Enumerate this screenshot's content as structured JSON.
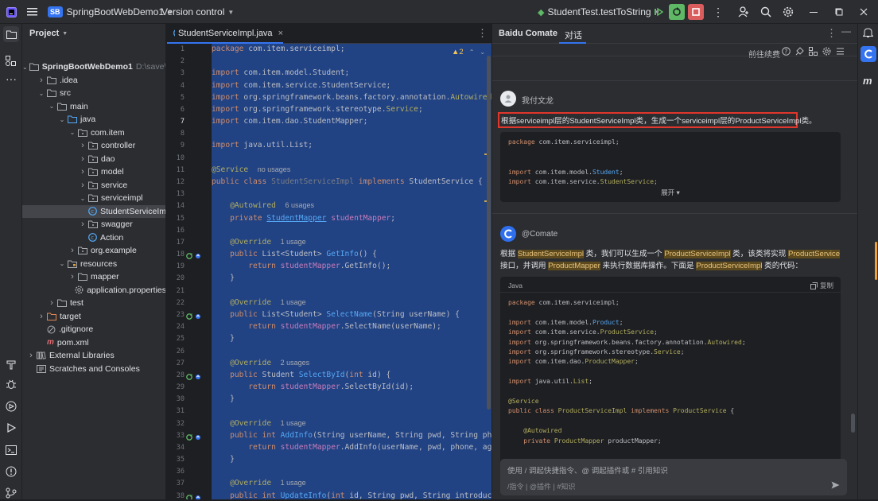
{
  "titlebar": {
    "project_badge": "SB",
    "project_name": "SpringBootWebDemo1",
    "vcs": "Version control",
    "run_config": "StudentTest.testToString"
  },
  "project_panel": {
    "title": "Project",
    "tree": [
      {
        "label": "SpringBootWebDemo1",
        "path": "D:\\save\\st",
        "depth": 0,
        "arrow": "open",
        "icon": "folder",
        "bold": true
      },
      {
        "label": ".idea",
        "depth": 1,
        "arrow": "closed",
        "icon": "folder"
      },
      {
        "label": "src",
        "depth": 1,
        "arrow": "open",
        "icon": "folder"
      },
      {
        "label": "main",
        "depth": 2,
        "arrow": "open",
        "icon": "folder"
      },
      {
        "label": "java",
        "depth": 3,
        "arrow": "open",
        "icon": "folder-blue"
      },
      {
        "label": "com.item",
        "depth": 4,
        "arrow": "open",
        "icon": "package"
      },
      {
        "label": "controller",
        "depth": 5,
        "arrow": "closed",
        "icon": "package"
      },
      {
        "label": "dao",
        "depth": 5,
        "arrow": "closed",
        "icon": "package"
      },
      {
        "label": "model",
        "depth": 5,
        "arrow": "closed",
        "icon": "package"
      },
      {
        "label": "service",
        "depth": 5,
        "arrow": "closed",
        "icon": "package"
      },
      {
        "label": "serviceimpl",
        "depth": 5,
        "arrow": "open",
        "icon": "package"
      },
      {
        "label": "StudentServiceIm",
        "depth": 6,
        "arrow": "none",
        "icon": "class",
        "selected": true
      },
      {
        "label": "swagger",
        "depth": 5,
        "arrow": "closed",
        "icon": "package"
      },
      {
        "label": "Action",
        "depth": 5,
        "arrow": "none",
        "icon": "class"
      },
      {
        "label": "org.example",
        "depth": 4,
        "arrow": "closed",
        "icon": "package"
      },
      {
        "label": "resources",
        "depth": 3,
        "arrow": "open",
        "icon": "folder-res"
      },
      {
        "label": "mapper",
        "depth": 4,
        "arrow": "closed",
        "icon": "folder"
      },
      {
        "label": "application.properties",
        "depth": 4,
        "arrow": "none",
        "icon": "gear"
      },
      {
        "label": "test",
        "depth": 2,
        "arrow": "closed",
        "icon": "folder"
      },
      {
        "label": "target",
        "depth": 1,
        "arrow": "closed",
        "icon": "folder-orange"
      },
      {
        "label": ".gitignore",
        "depth": 1,
        "arrow": "none",
        "icon": "ignore"
      },
      {
        "label": "pom.xml",
        "depth": 1,
        "arrow": "none",
        "icon": "maven"
      },
      {
        "label": "External Libraries",
        "depth": 0,
        "arrow": "closed",
        "icon": "libs"
      },
      {
        "label": "Scratches and Consoles",
        "depth": 0,
        "arrow": "none",
        "icon": "scratch"
      }
    ]
  },
  "editor": {
    "tab_label": "StudentServiceImpl.java",
    "warning_count": "▲2",
    "lines": [
      {
        "n": "1",
        "html": "<span class='kw'>package</span> com.item.serviceimpl;"
      },
      {
        "n": "2",
        "html": ""
      },
      {
        "n": "3",
        "html": "<span class='kw'>import</span> com.item.model.Student;"
      },
      {
        "n": "4",
        "html": "<span class='kw'>import</span> com.item.service.StudentService;"
      },
      {
        "n": "5",
        "html": "<span class='kw'>import</span> org.springframework.beans.factory.annotation.<span class='an'>Autowired</span>;"
      },
      {
        "n": "6",
        "html": "<span class='kw'>import</span> org.springframework.stereotype.<span class='an'>Service</span>;"
      },
      {
        "n": "7",
        "html": "<span class='kw'>import</span> com.item.dao.StudentMapper;"
      },
      {
        "n": "8",
        "html": ""
      },
      {
        "n": "9",
        "html": "<span class='kw'>import</span> java.util.List;"
      },
      {
        "n": "10",
        "html": ""
      },
      {
        "n": "11",
        "html": "<span class='an'>@Service</span>  <span class='hint'>no usages</span>"
      },
      {
        "n": "12",
        "html": "<span class='kw'>public class</span> <span class='gr'>StudentServiceImpl</span> <span class='kw'>implements</span> StudentService {"
      },
      {
        "n": "13",
        "html": ""
      },
      {
        "n": "14",
        "html": "    <span class='an'>@Autowired</span>  <span class='hint'>6 usages</span>"
      },
      {
        "n": "15",
        "html": "    <span class='kw'>private</span> <span class='fn' style='text-decoration:underline'>StudentMapper</span> <span class='fd'>studentMapper</span>;"
      },
      {
        "n": "16",
        "html": ""
      },
      {
        "n": "17",
        "html": "    <span class='an'>@Override</span>  <span class='hint'>1 usage</span>"
      },
      {
        "n": "18",
        "html": "    <span class='kw'>public</span> List&lt;Student&gt; <span class='fn'>GetInfo</span>() {"
      },
      {
        "n": "19",
        "html": "        <span class='kw'>return</span> <span class='fd'>studentMapper</span>.GetInfo();"
      },
      {
        "n": "20",
        "html": "    }"
      },
      {
        "n": "21",
        "html": ""
      },
      {
        "n": "22",
        "html": "    <span class='an'>@Override</span>  <span class='hint'>1 usage</span>"
      },
      {
        "n": "23",
        "html": "    <span class='kw'>public</span> List&lt;Student&gt; <span class='fn'>SelectName</span>(String userName) {"
      },
      {
        "n": "24",
        "html": "        <span class='kw'>return</span> <span class='fd'>studentMapper</span>.SelectName(userName);"
      },
      {
        "n": "25",
        "html": "    }"
      },
      {
        "n": "26",
        "html": ""
      },
      {
        "n": "27",
        "html": "    <span class='an'>@Override</span>  <span class='hint'>2 usages</span>"
      },
      {
        "n": "28",
        "html": "    <span class='kw'>public</span> Student <span class='fn'>SelectById</span>(<span class='kw'>int</span> id) {"
      },
      {
        "n": "29",
        "html": "        <span class='kw'>return</span> <span class='fd'>studentMapper</span>.SelectById(id);"
      },
      {
        "n": "30",
        "html": "    }"
      },
      {
        "n": "31",
        "html": ""
      },
      {
        "n": "32",
        "html": "    <span class='an'>@Override</span>  <span class='hint'>1 usage</span>"
      },
      {
        "n": "33",
        "html": "    <span class='kw'>public int</span> <span class='fn'>AddInfo</span>(String userName, String pwd, String phone"
      },
      {
        "n": "34",
        "html": "        <span class='kw'>return</span> <span class='fd'>studentMapper</span>.AddInfo(userName, pwd, phone, age,"
      },
      {
        "n": "35",
        "html": "    }"
      },
      {
        "n": "36",
        "html": ""
      },
      {
        "n": "37",
        "html": "    <span class='an'>@Override</span>  <span class='hint'>1 usage</span>"
      },
      {
        "n": "38",
        "html": "    <span class='kw'>public int</span> <span class='fn'>UpdateInfo</span>(<span class='kw'>int</span> id, String pwd, String introduce)"
      }
    ]
  },
  "chat": {
    "brand": "Baidu Comate",
    "tab": "对话",
    "toolbar_label": "前往续费",
    "user_name": "我付文龙",
    "user_msg": "根据serviceimpl层的StudentServiceImpl类，生成一个serviceimpl层的ProductServiceImpl类。",
    "user_code": [
      {
        "html": "<span class='kw'>package</span> com.item.serviceimpl;"
      },
      {
        "html": ""
      },
      {
        "html": ""
      },
      {
        "html": "<span class='kw'>import</span> com.item.model.<span class='fn'>Student</span>;"
      },
      {
        "html": "<span class='kw'>import</span> com.item.service.<span class='an'>StudentService</span>;"
      }
    ],
    "expand_label": "展开 ▾",
    "bot_name": "@Comate",
    "bot_msg_html": "根据 <span class='hl'>StudentServiceImpl</span> 类，我们可以生成一个 <span class='hl'>ProductServiceImpl</span> 类，该类将实现 <span class='hl'>ProductService</span> 接口，并调用 <span class='hl'>ProductMapper</span> 来执行数据库操作。下面是 <span class='hl'>ProductServiceImpl</span> 类的代码：",
    "code_lang": "Java",
    "copy_label": "复制",
    "bot_code": [
      {
        "html": "<span class='kw'>package</span> com.item.serviceimpl;"
      },
      {
        "html": ""
      },
      {
        "html": "<span class='kw'>import</span> com.item.model.<span class='fn'>Product</span>;"
      },
      {
        "html": "<span class='kw'>import</span> com.item.service.<span class='an'>ProductService</span>;"
      },
      {
        "html": "<span class='kw'>import</span> org.springframework.beans.factory.annotation.<span class='an'>Autowired</span>;"
      },
      {
        "html": "<span class='kw'>import</span> org.springframework.stereotype.<span class='an'>Service</span>;"
      },
      {
        "html": "<span class='kw'>import</span> com.item.dao.<span class='an'>ProductMapper</span>;"
      },
      {
        "html": ""
      },
      {
        "html": "<span class='kw'>import</span> java.util.<span class='an'>List</span>;"
      },
      {
        "html": ""
      },
      {
        "html": "<span class='an'>@Service</span>"
      },
      {
        "html": "<span class='kw'>public class</span> <span class='an'>ProductServiceImpl</span> <span class='kw'>implements</span> <span class='an'>ProductService</span> {"
      },
      {
        "html": ""
      },
      {
        "html": "    <span class='an'>@Autowired</span>"
      },
      {
        "html": "    <span class='kw'>private</span> <span class='an'>ProductMapper</span> productMapper;"
      }
    ],
    "input_placeholder": "使用 / 调起快捷指令、@ 调起插件或 # 引用知识",
    "input_hints": "/指令 | @插件 | #知识"
  },
  "colors": {
    "accent": "#3574f0",
    "selection": "#214283",
    "highlight_box": "#e0362c"
  }
}
